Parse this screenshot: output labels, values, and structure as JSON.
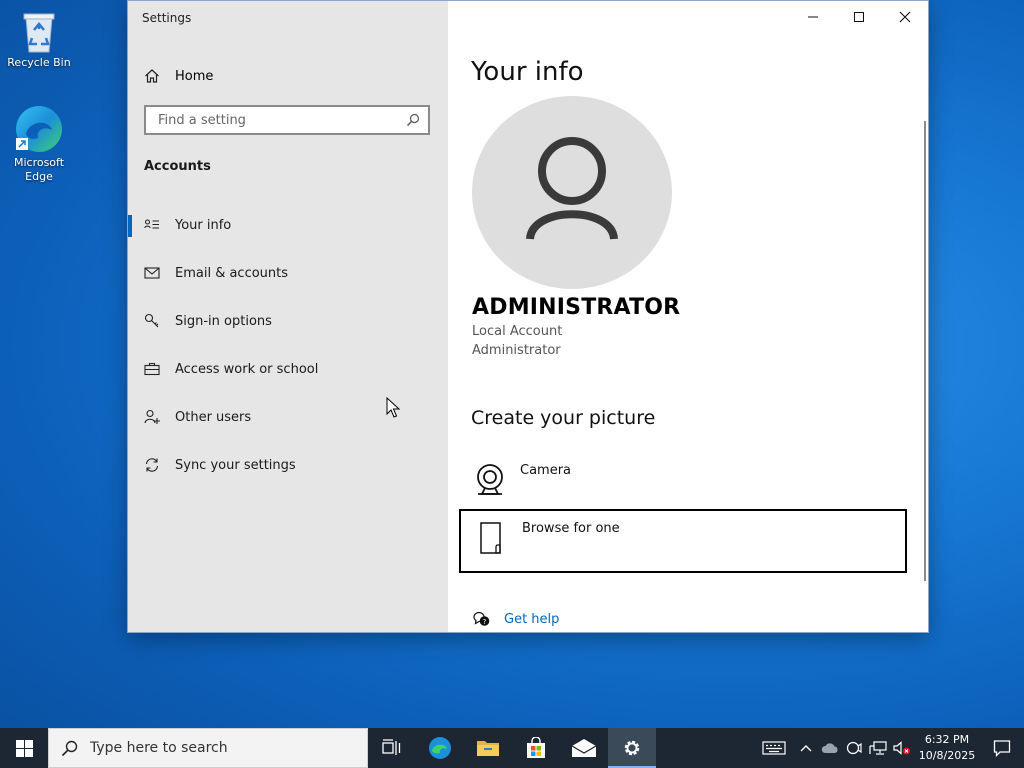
{
  "desktop": {
    "icons": [
      {
        "label": "Recycle Bin"
      },
      {
        "label": "Microsoft Edge"
      }
    ]
  },
  "window": {
    "title": "Settings",
    "sidebar": {
      "home_label": "Home",
      "search_placeholder": "Find a setting",
      "section_title": "Accounts",
      "items": [
        {
          "label": "Your info",
          "icon": "your-info-icon",
          "active": true
        },
        {
          "label": "Email & accounts",
          "icon": "email-icon"
        },
        {
          "label": "Sign-in options",
          "icon": "key-icon"
        },
        {
          "label": "Access work or school",
          "icon": "briefcase-icon"
        },
        {
          "label": "Other users",
          "icon": "add-user-icon"
        },
        {
          "label": "Sync your settings",
          "icon": "sync-icon"
        }
      ]
    },
    "content": {
      "heading": "Your info",
      "user_name": "ADMINISTRATOR",
      "account_type": "Local Account",
      "role": "Administrator",
      "picture_heading": "Create your picture",
      "options": [
        {
          "label": "Camera",
          "icon": "camera-icon"
        },
        {
          "label": "Browse for one",
          "icon": "file-icon"
        }
      ],
      "help_label": "Get help"
    }
  },
  "taskbar": {
    "search_placeholder": "Type here to search",
    "time": "6:32 PM",
    "date": "10/8/2025"
  },
  "colors": {
    "accent": "#0067c0",
    "sidebar_bg": "#e6e6e6",
    "taskbar_bg": "#1c2733"
  }
}
